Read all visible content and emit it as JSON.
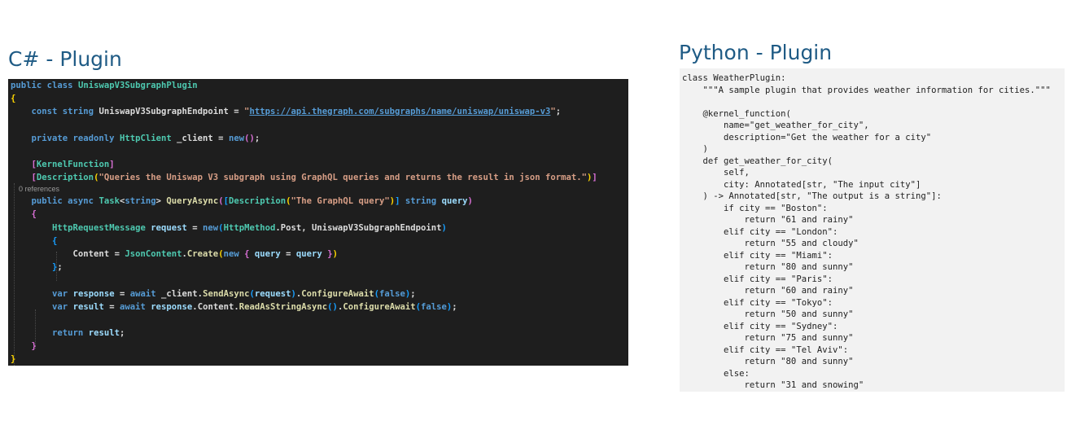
{
  "headings": {
    "csharp": "C# - Plugin",
    "python": "Python - Plugin"
  },
  "colors": {
    "heading": "#1f5b85",
    "editor_background": "#1e1e1e",
    "python_background": "#f2f2f2",
    "keyword": "#569cd6",
    "type": "#4ec9b0",
    "method": "#dcdcaa",
    "string": "#d69d85",
    "identifier": "#9cdcfe",
    "bracket": "#ffd700"
  },
  "csharp": {
    "class_keywords": "public class",
    "class_name": "UniswapV3SubgraphPlugin",
    "const_keywords": "const string",
    "endpoint_name": "UniswapV3SubgraphEndpoint",
    "endpoint_url": "https://api.thegraph.com/subgraphs/name/uniswap/uniswap-v3",
    "field_keywords": "private readonly",
    "http_client_type": "HttpClient",
    "client_field": "_client",
    "new_keyword": "new",
    "kernel_attribute": "KernelFunction",
    "description_attribute": "Description",
    "description_text": "\"Queries the Uniswap V3 subgraph using GraphQL queries and returns the result in json format.\"",
    "references": "0 references",
    "method_keywords": "public async",
    "task_type": "Task",
    "string_keyword": "string",
    "method_name": "QueryAsync",
    "param_description": "\"The GraphQL query\"",
    "param_name": "query",
    "request_type": "HttpRequestMessage",
    "request_var": "request",
    "http_method_type": "HttpMethod",
    "post": "Post",
    "content_prop": "Content",
    "json_content_type": "JsonContent",
    "create_method": "Create",
    "var_keyword": "var",
    "response_var": "response",
    "await_keyword": "await",
    "send_async": "SendAsync",
    "configure_await": "ConfigureAwait",
    "false_keyword": "false",
    "result_var": "result",
    "read_as_string": "ReadAsStringAsync",
    "return_keyword": "return"
  },
  "python": {
    "lines": [
      "class WeatherPlugin:",
      "    \"\"\"A sample plugin that provides weather information for cities.\"\"\"",
      "",
      "    @kernel_function(",
      "        name=\"get_weather_for_city\",",
      "        description=\"Get the weather for a city\"",
      "    )",
      "    def get_weather_for_city(",
      "        self,",
      "        city: Annotated[str, \"The input city\"]",
      "    ) -> Annotated[str, \"The output is a string\"]:",
      "        if city == \"Boston\":",
      "            return \"61 and rainy\"",
      "        elif city == \"London\":",
      "            return \"55 and cloudy\"",
      "        elif city == \"Miami\":",
      "            return \"80 and sunny\"",
      "        elif city == \"Paris\":",
      "            return \"60 and rainy\"",
      "        elif city == \"Tokyo\":",
      "            return \"50 and sunny\"",
      "        elif city == \"Sydney\":",
      "            return \"75 and sunny\"",
      "        elif city == \"Tel Aviv\":",
      "            return \"80 and sunny\"",
      "        else:",
      "            return \"31 and snowing\""
    ]
  }
}
